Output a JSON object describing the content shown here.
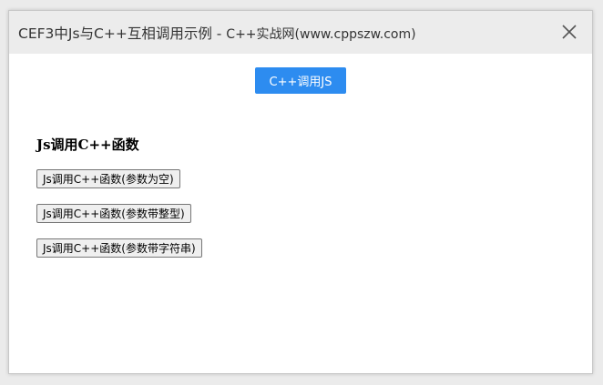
{
  "window": {
    "title_main": "CEF3中Js与C++互相调用示例 - ",
    "title_sub": "C++实战网(www.cppszw.com)",
    "close_icon": "close-icon"
  },
  "main": {
    "cpp_call_js_label": "C++调用JS",
    "section_heading": "Js调用C++函数",
    "buttons": [
      "Js调用C++函数(参数为空)",
      "Js调用C++函数(参数带整型)",
      "Js调用C++函数(参数带字符串)"
    ]
  },
  "colors": {
    "accent": "#2d8cf0",
    "titlebar": "#ececec"
  }
}
